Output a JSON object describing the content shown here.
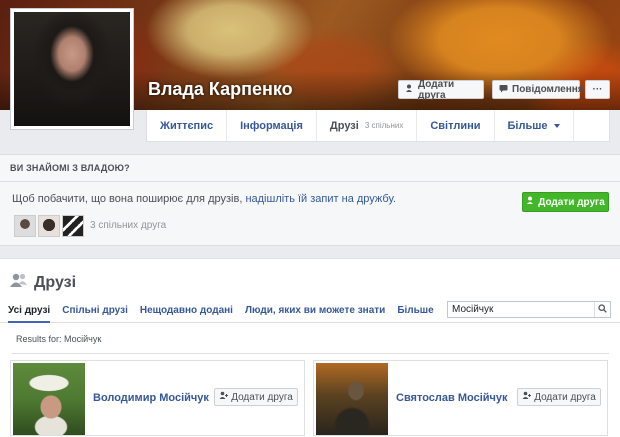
{
  "profile": {
    "name": "Влада Карпенко",
    "buttons": {
      "add_friend": "Додати друга",
      "message": "Повідомлення",
      "more": "···"
    }
  },
  "tabs": [
    {
      "label": "Життєпис"
    },
    {
      "label": "Інформація"
    },
    {
      "label": "Друзі",
      "sub": "3 спільних"
    },
    {
      "label": "Світлини"
    },
    {
      "label": "Більше"
    }
  ],
  "know_panel": {
    "heading": "ВИ ЗНАЙОМІ З ВЛАДОЮ?",
    "text": "Щоб побачити, що вона поширює для друзів, ",
    "link": "надішліть їй запит на дружбу.",
    "mutual": "3 спільних друга",
    "button": "Додати друга"
  },
  "friends": {
    "title": "Друзі",
    "tabs": [
      "Усі друзі",
      "Спільні друзі",
      "Нещодавно додані",
      "Люди, яких ви можете знати",
      "Більше"
    ],
    "search_value": "Мосійчук",
    "results_for": "Results for: Мосійчук",
    "cards": [
      {
        "name": "Володимир Мосійчук",
        "button": "Додати друга"
      },
      {
        "name": "Святослав Мосійчук",
        "button": "Додати друга"
      }
    ]
  }
}
